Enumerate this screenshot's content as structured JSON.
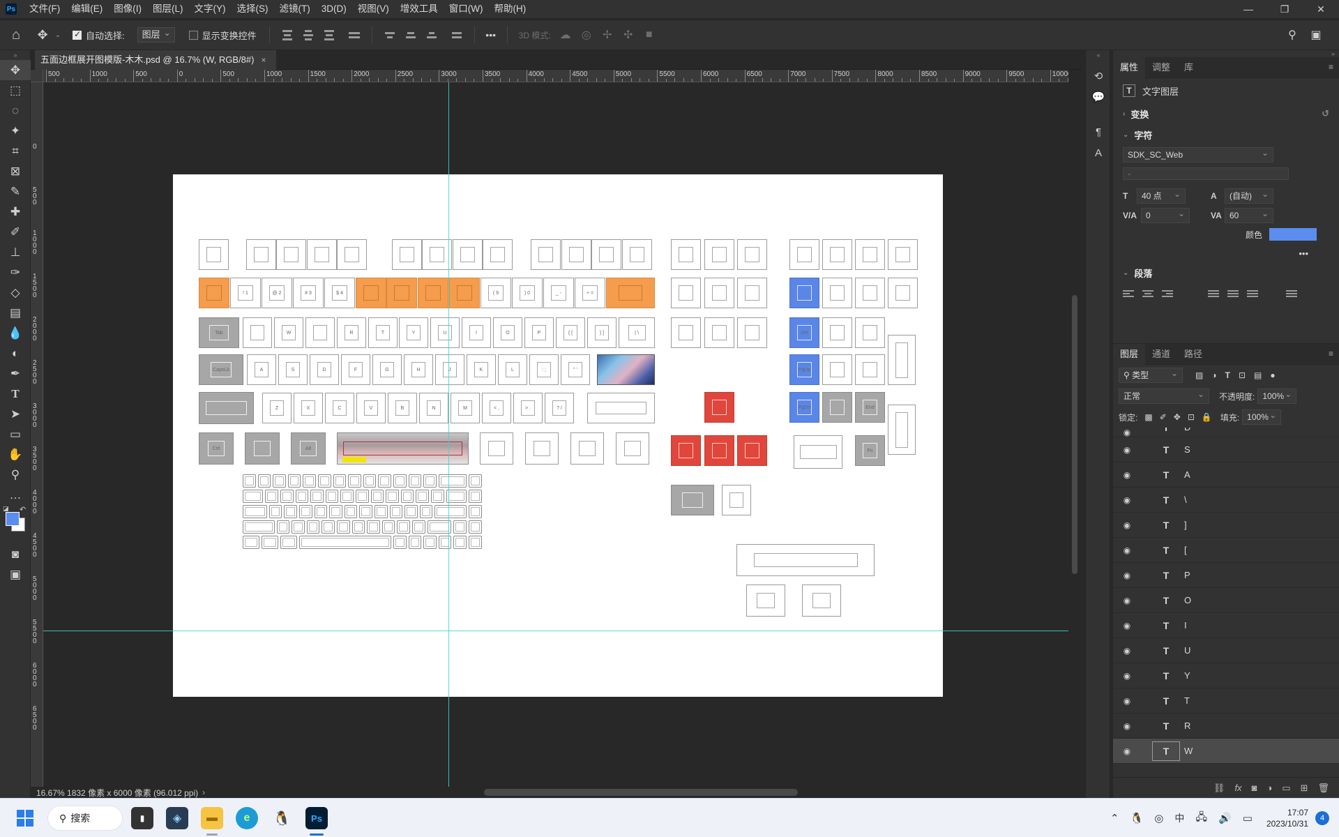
{
  "menubar": {
    "logo": "Ps",
    "items": [
      "文件(F)",
      "编辑(E)",
      "图像(I)",
      "图层(L)",
      "文字(Y)",
      "选择(S)",
      "滤镜(T)",
      "3D(D)",
      "视图(V)",
      "增效工具",
      "窗口(W)",
      "帮助(H)"
    ]
  },
  "optionsbar": {
    "auto_select_label": "自动选择:",
    "auto_select_checked": true,
    "auto_select_target": "图层",
    "show_transform_label": "显示变换控件",
    "show_transform_checked": false,
    "mode_3d_label": "3D 模式:",
    "more": "•••"
  },
  "document": {
    "tab_title": "五面边框展开图模版-木木.psd @ 16.7% (W, RGB/8#)",
    "close": "×",
    "status": "16.67%  1832 像素 x 6000 像素 (96.012 ppi)",
    "status_arrow": "›"
  },
  "ruler": {
    "top_labels": [
      "500",
      "1000",
      "500",
      "0",
      "500",
      "1000",
      "1500",
      "2000",
      "2500",
      "3000",
      "3500",
      "4000",
      "4500",
      "5000",
      "5500",
      "6000",
      "6500",
      "7000",
      "7500",
      "8000",
      "8500",
      "9000",
      "9500",
      "10000"
    ],
    "left_labels": [
      "0",
      "5 0 0",
      "1 0 0 0",
      "1 5 0 0",
      "2 0 0 0",
      "2 5 0 0",
      "3 0 0 0",
      "3 5 0 0",
      "4 0 0 0",
      "4 5 0 0",
      "5 0 0 0",
      "5 5 0 0",
      "6 0 0 0",
      "6 5 0 0"
    ]
  },
  "properties_panel": {
    "tabs": [
      "属性",
      "调整",
      "库"
    ],
    "layer_kind": "文字图层",
    "transform_label": "变换",
    "character_label": "字符",
    "font_family": "SDK_SC_Web",
    "font_style": "-",
    "font_size": "40 点",
    "leading": "(自动)",
    "kerning": "0",
    "tracking": "60",
    "color_label": "颜色",
    "text_color": "#5b8def",
    "more": "•••",
    "paragraph_label": "段落"
  },
  "layers_panel": {
    "tabs": [
      "图层",
      "通道",
      "路径"
    ],
    "filter_kind": "类型",
    "blend_mode": "正常",
    "opacity_label": "不透明度:",
    "opacity": "100%",
    "lock_label": "锁定:",
    "fill_label": "填充:",
    "fill": "100%",
    "partial_top": "D",
    "layers": [
      "S",
      "A",
      "\\",
      "]",
      "[",
      "P",
      "O",
      "I",
      "U",
      "Y",
      "T",
      "R",
      "W"
    ],
    "selected_layer": "W"
  },
  "taskbar": {
    "search_label": "搜索",
    "ime": "中",
    "time": "17:07",
    "date": "2023/10/31",
    "notifications": "4"
  },
  "keyboard": {
    "row1": [
      "",
      "",
      "",
      "",
      "",
      "",
      "",
      "",
      "",
      "",
      "",
      "",
      ""
    ],
    "row2": [
      "",
      "! 1",
      "@ 2",
      "# 3",
      "$ 4",
      "",
      "",
      "",
      "",
      "( 9",
      ") 0",
      "_ -",
      "+ ="
    ],
    "row3": [
      "Tab",
      "",
      "W",
      "",
      "R",
      "T",
      "Y",
      "U",
      "I",
      "O",
      "P",
      "{ [",
      "} ]",
      "| \\"
    ],
    "row4": [
      "CapsLk",
      "A",
      "S",
      "D",
      "F",
      "G",
      "H",
      "J",
      "K",
      "L",
      ": ;",
      "\" '"
    ],
    "row5": [
      "",
      "Z",
      "X",
      "C",
      "V",
      "B",
      "N",
      "M",
      "< ,",
      "> .",
      "? /"
    ],
    "row6": [
      "Ctrl",
      "",
      "Alt"
    ],
    "nav_labels": [
      "Del",
      "PgUp",
      "PgDn",
      "End",
      "Fn"
    ]
  },
  "colors": {
    "orange": "#f59c4d",
    "blue": "#5a86e8",
    "red": "#e0463c",
    "guide": "#3fd3d3",
    "highlight": "#f2e600"
  }
}
